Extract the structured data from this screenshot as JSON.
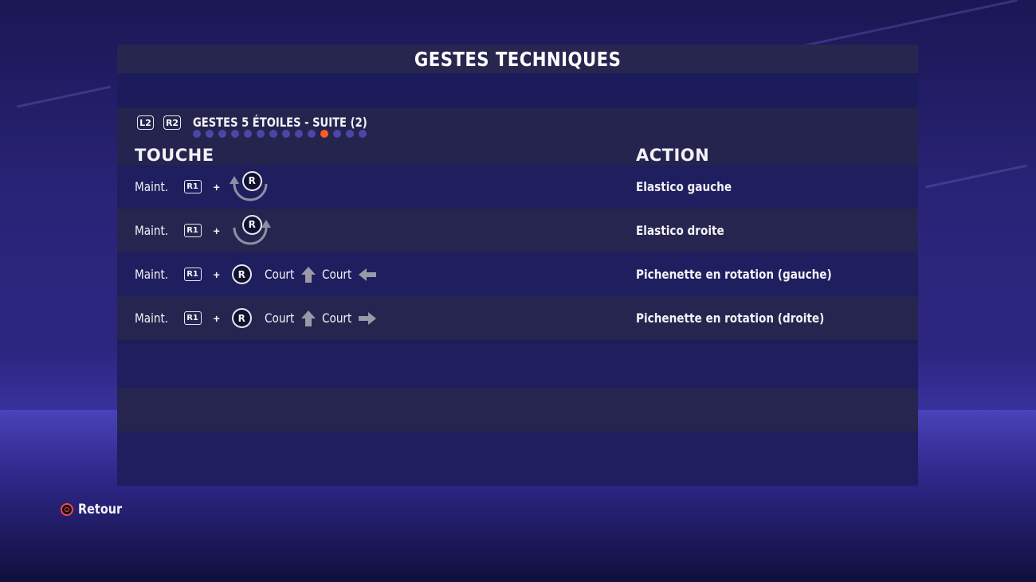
{
  "header": {
    "title": "GESTES TECHNIQUES"
  },
  "category": {
    "left_button": "L2",
    "right_button": "R2",
    "title": "GESTES 5 ÉTOILES - SUITE (2)",
    "page_count": 14,
    "active_page": 11
  },
  "columns": {
    "input": "TOUCHE",
    "action": "ACTION"
  },
  "moves": [
    {
      "hold": "Maint.",
      "button": "R1",
      "plus": "+",
      "stick": "R",
      "gesture": "rotate-left",
      "action": "Elastico gauche"
    },
    {
      "hold": "Maint.",
      "button": "R1",
      "plus": "+",
      "stick": "R",
      "gesture": "rotate-right",
      "action": "Elastico droite"
    },
    {
      "hold": "Maint.",
      "button": "R1",
      "plus": "+",
      "stick": "R",
      "gesture": "flicks",
      "flick1": "Court",
      "flick1_dir": "up",
      "flick2": "Court",
      "flick2_dir": "left",
      "action": "Pichenette en rotation (gauche)"
    },
    {
      "hold": "Maint.",
      "button": "R1",
      "plus": "+",
      "stick": "R",
      "gesture": "flicks",
      "flick1": "Court",
      "flick1_dir": "up",
      "flick2": "Court",
      "flick2_dir": "right",
      "action": "Pichenette en rotation (droite)"
    }
  ],
  "footer": {
    "back_label": "Retour",
    "back_icon": "circle-button-icon"
  },
  "colors": {
    "accent": "#ff5a1f",
    "panel": "#1d1c58",
    "row_alt": "#26254f"
  }
}
